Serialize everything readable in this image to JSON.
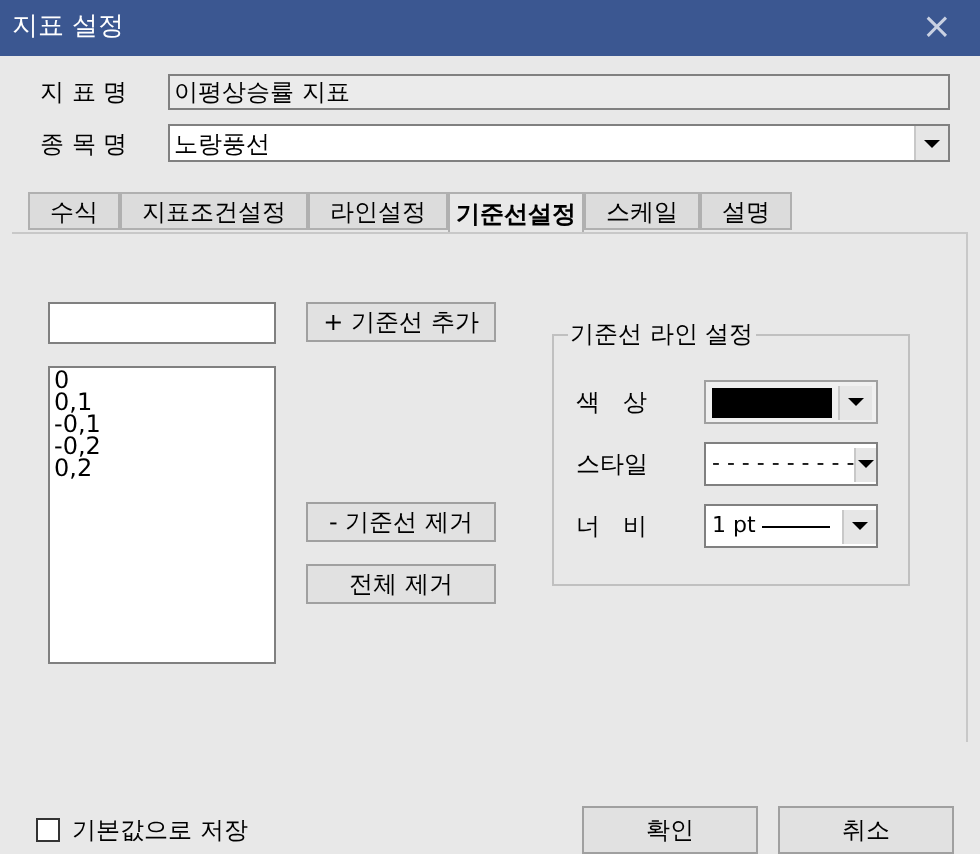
{
  "window": {
    "title": "지표 설정",
    "close": "×"
  },
  "fields": [
    {
      "kind": "readonly",
      "label": "지 표 명",
      "value": "이평상승률 지표"
    },
    {
      "kind": "dropdown",
      "label": "종 목 명",
      "value": "노랑풍선"
    }
  ],
  "tabs": [
    {
      "label": "수식",
      "selected": false
    },
    {
      "label": "지표조건설정",
      "selected": false
    },
    {
      "label": "라인설정",
      "selected": false
    },
    {
      "label": "기준선설정",
      "selected": true
    },
    {
      "label": "스케일",
      "selected": false
    },
    {
      "label": "설명",
      "selected": false
    }
  ],
  "baseline_list": {
    "items": [
      "0",
      "0,1",
      "-0,1",
      "-0,2",
      "0,2"
    ]
  },
  "buttons": {
    "add": "+ 기준선 추가",
    "remove": "- 기준선 제거",
    "remove_all": "전체 제거"
  },
  "line_settings": {
    "title": "기준선 라인 설정",
    "rows": [
      {
        "kind": "color",
        "label": "색   상",
        "color": "#000000"
      },
      {
        "kind": "style",
        "label": "스타일",
        "value": "- - - - - - - - - -"
      },
      {
        "kind": "width",
        "label": "너   비",
        "value": "1 pt"
      }
    ]
  },
  "save_default": {
    "label": "기본값으로 저장",
    "checked": false
  },
  "footer_buttons": [
    "확인",
    "취소"
  ]
}
